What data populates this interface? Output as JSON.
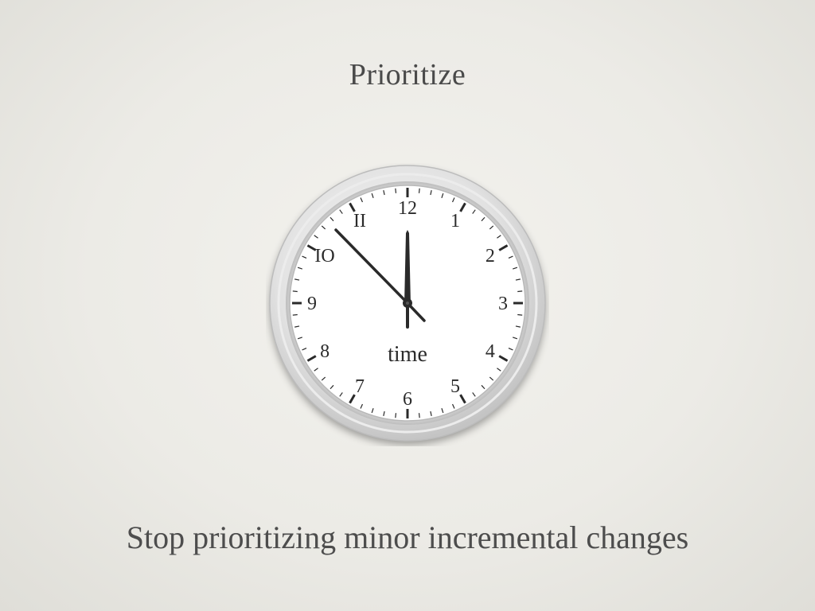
{
  "slide": {
    "title": "Prioritize",
    "subtitle": "Stop prioritizing minor incremental changes"
  },
  "clock": {
    "face_word": "time",
    "numerals": [
      "12",
      "1",
      "2",
      "3",
      "4",
      "5",
      "6",
      "7",
      "8",
      "9",
      "IO",
      "II"
    ],
    "time_shown": "11:55",
    "colors": {
      "frame": "#d9d9d9",
      "face": "#ffffff",
      "hands": "#2a2a2a",
      "text": "#2b2b2b"
    }
  }
}
